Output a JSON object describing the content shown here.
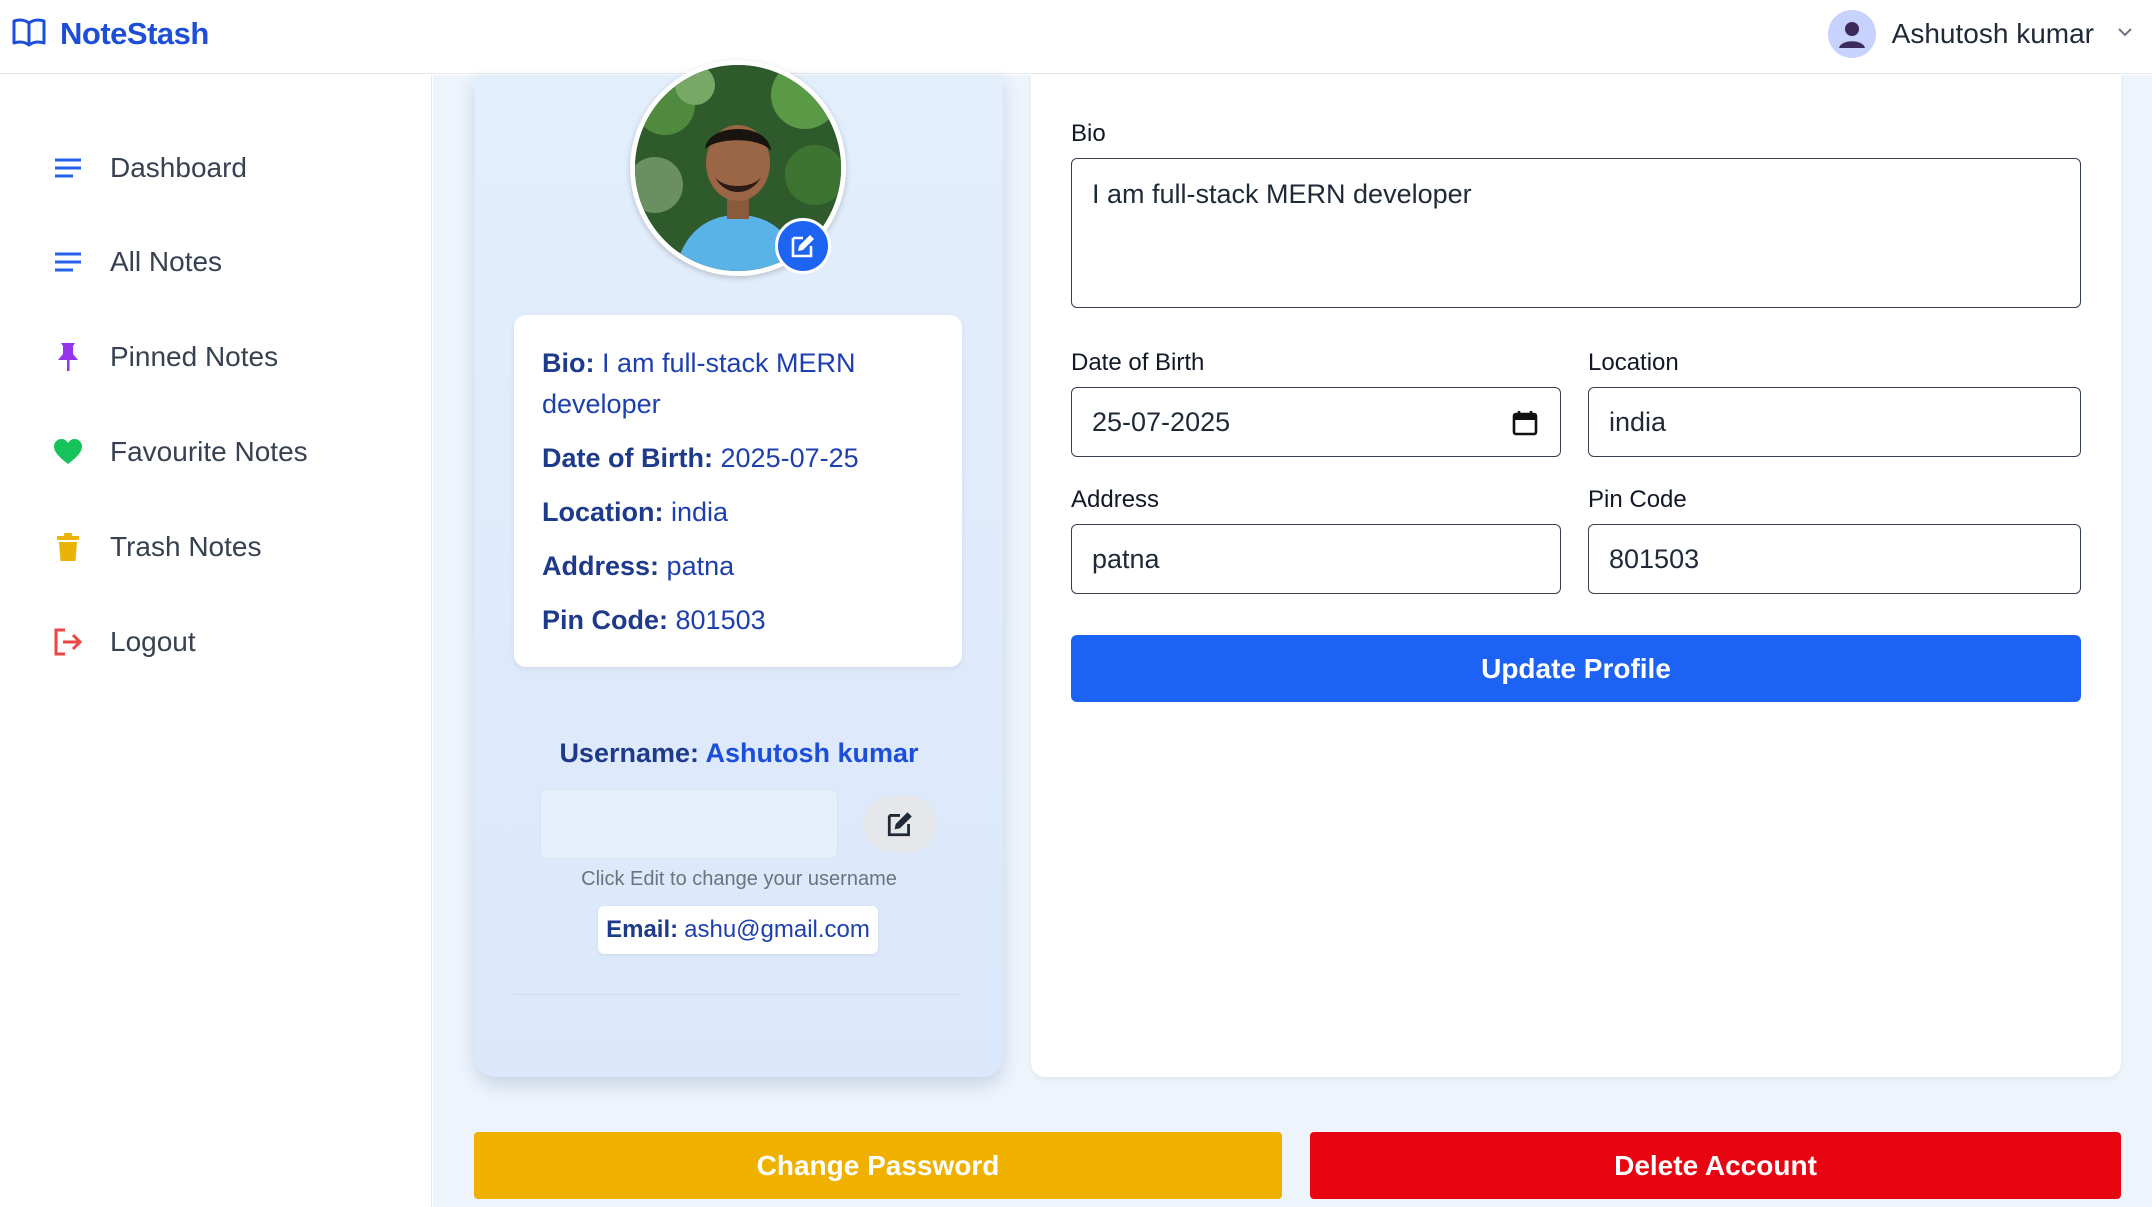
{
  "app": {
    "name": "NoteStash"
  },
  "user_menu": {
    "name": "Ashutosh kumar"
  },
  "sidebar": {
    "items": [
      {
        "label": "Dashboard",
        "icon": "lines-icon"
      },
      {
        "label": "All Notes",
        "icon": "lines-icon"
      },
      {
        "label": "Pinned Notes",
        "icon": "pin-icon"
      },
      {
        "label": "Favourite Notes",
        "icon": "heart-icon"
      },
      {
        "label": "Trash Notes",
        "icon": "trash-icon"
      },
      {
        "label": "Logout",
        "icon": "logout-icon"
      }
    ]
  },
  "profile": {
    "info": {
      "bio_label": "Bio:",
      "bio_value": "I am full-stack MERN developer",
      "dob_label": "Date of Birth:",
      "dob_value": "2025-07-25",
      "location_label": "Location:",
      "location_value": "india",
      "address_label": "Address:",
      "address_value": "patna",
      "pin_label": "Pin Code:",
      "pin_value": "801503"
    },
    "username_label": "Username:",
    "username_value": "Ashutosh kumar",
    "username_input": "",
    "username_hint": "Click Edit to change your username",
    "email_label": "Email:",
    "email_value": "ashu@gmail.com"
  },
  "form": {
    "bio_label": "Bio",
    "bio_value": "I am full-stack MERN developer",
    "dob_label": "Date of Birth",
    "dob_value": "25-07-2025",
    "location_label": "Location",
    "location_value": "india",
    "address_label": "Address",
    "address_value": "patna",
    "pin_label": "Pin Code",
    "pin_value": "801503",
    "update_label": "Update Profile"
  },
  "actions": {
    "change_password": "Change Password",
    "delete_account": "Delete Account"
  },
  "colors": {
    "brand": "#1d4ed8",
    "primary_button": "#1c62f4",
    "warning_button": "#efb000",
    "danger_button": "#e80512"
  }
}
